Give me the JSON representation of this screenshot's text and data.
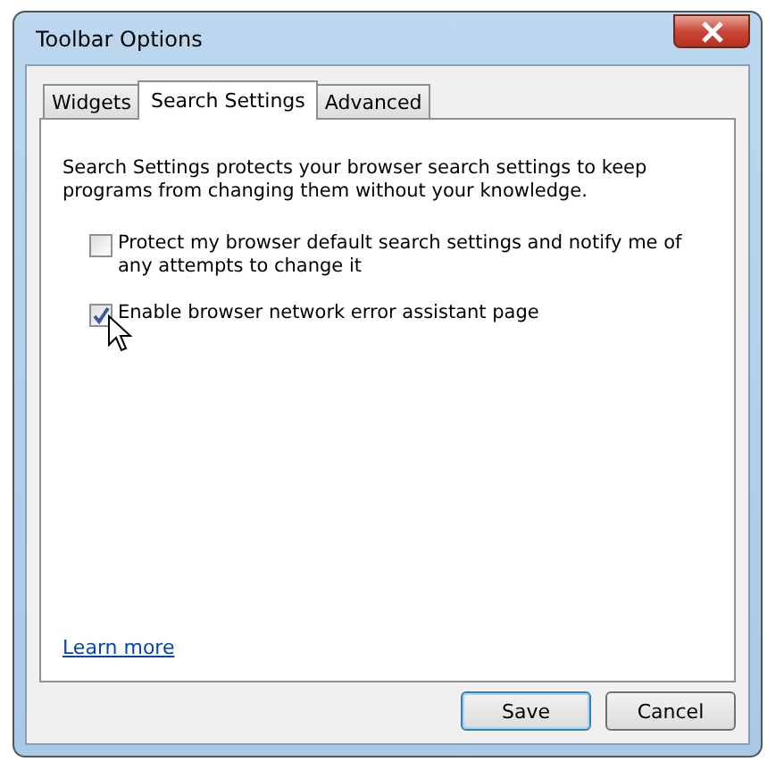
{
  "window": {
    "title": "Toolbar Options"
  },
  "tabs": [
    {
      "label": "Widgets",
      "selected": false
    },
    {
      "label": "Search Settings",
      "selected": true
    },
    {
      "label": "Advanced",
      "selected": false
    }
  ],
  "description": "Search Settings protects your browser search settings to keep programs from changing them without your knowledge.",
  "options": [
    {
      "label": "Protect my browser default search settings and notify me of any attempts to change it",
      "checked": false
    },
    {
      "label": "Enable browser network error assistant page",
      "checked": true
    }
  ],
  "link": "Learn more",
  "buttons": [
    {
      "label": "Save",
      "default": true
    },
    {
      "label": "Cancel",
      "default": false
    }
  ]
}
